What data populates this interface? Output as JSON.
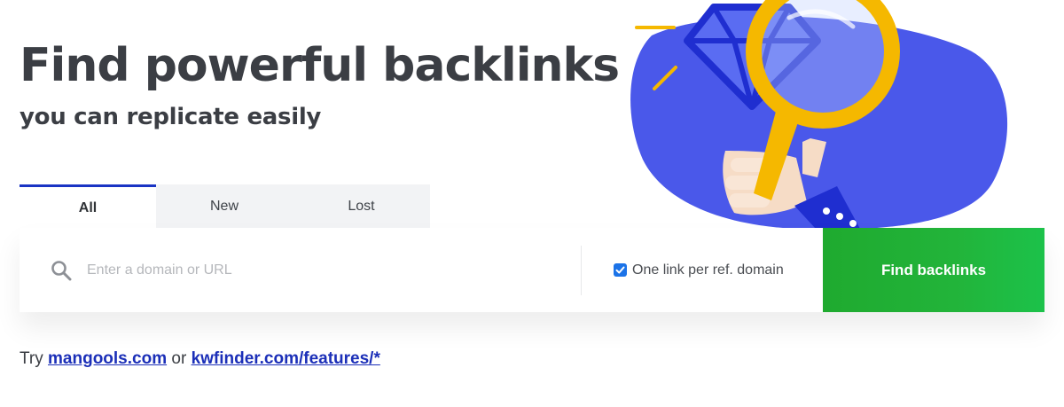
{
  "hero": {
    "title": "Find powerful backlinks",
    "subtitle": "you can replicate easily"
  },
  "illustration": {
    "icons": [
      "diamond-icon",
      "magnifier-icon",
      "hand-icon"
    ],
    "colors": {
      "blob": "#4a58ea",
      "diamond": "#2a38d8",
      "magnifier": "#f5b800"
    }
  },
  "tabs": [
    {
      "label": "All",
      "active": true
    },
    {
      "label": "New",
      "active": false
    },
    {
      "label": "Lost",
      "active": false
    }
  ],
  "search": {
    "placeholder": "Enter a domain or URL",
    "value": "",
    "icon": "search-icon"
  },
  "option": {
    "label": "One link per ref. domain",
    "checked": true
  },
  "button": {
    "label": "Find backlinks",
    "color": "#22b43a"
  },
  "suggestions": {
    "prefix": "Try",
    "link1": "mangools.com",
    "separator": "or",
    "link2": "kwfinder.com/features/*"
  }
}
